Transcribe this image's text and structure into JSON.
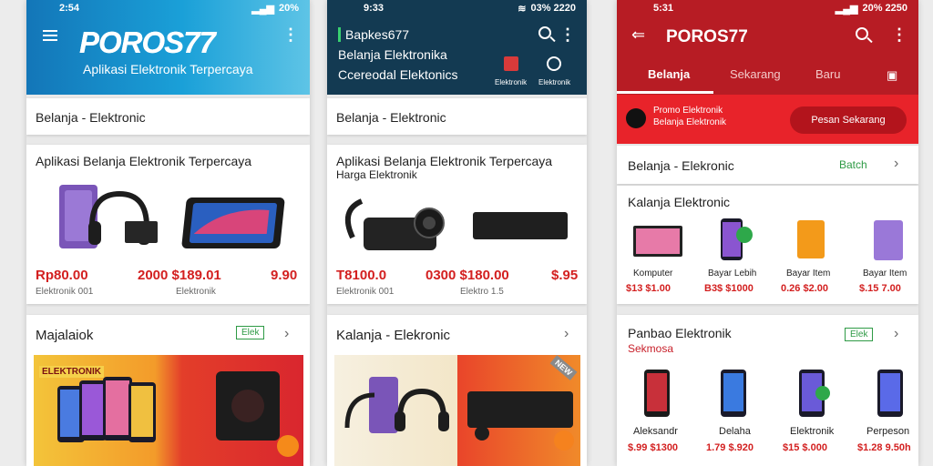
{
  "phone1": {
    "status": {
      "time": "2:54",
      "battery": "20%"
    },
    "logo": "POROS77",
    "tagline": "Aplikasi Elektronik Terpercaya",
    "category_bar": "Belanja - Elektronic",
    "card1": {
      "title": "Aplikasi Belanja Elektronik Terpercaya",
      "prices": [
        "Rp80.00",
        "2000 $189.01",
        "9.90"
      ],
      "subs": [
        "Elektronik 001",
        "Elektronik"
      ]
    },
    "card2": {
      "title": "Majalaiok",
      "badge": "Elek",
      "banner_label": "ELEKTRONIK"
    }
  },
  "phone2": {
    "status": {
      "time": "9:33",
      "battery": "03% 2220"
    },
    "title": "Bapkes677",
    "subtitle1": "Belanja Elektronika",
    "subtitle2": "Ccereodal Elektonics",
    "icon_labels": [
      "Elektronik",
      "Elektronik"
    ],
    "category_bar": "Belanja - Elektronic",
    "card1": {
      "title": "Aplikasi Belanja Elektronik Terpercaya",
      "subtitle": "Harga Elektronik",
      "prices": [
        "T8100.0",
        "0300 $180.00",
        "$.95"
      ],
      "subs": [
        "Elektronik 001",
        "Elektro 1.5"
      ]
    },
    "card2": {
      "title": "Kalanja - Elekronic",
      "ribbon": "NEW"
    }
  },
  "phone3": {
    "status": {
      "time": "5:31",
      "battery": "20% 2250"
    },
    "logo": "POROS77",
    "tabs": [
      "Belanja",
      "Sekarang",
      "Baru"
    ],
    "promo": {
      "line1": "Promo Elektronik",
      "line2": "Belanja Elektronik",
      "button": "Pesan Sekarang"
    },
    "row1": {
      "title": "Belanja - Elekronic",
      "link": "Batch"
    },
    "card1": {
      "title": "Kalanja Elektronic",
      "items": [
        {
          "name": "Komputer",
          "price": "$13 $1.00"
        },
        {
          "name": "Bayar Lebih",
          "price": "B3$ $1000"
        },
        {
          "name": "Bayar Item",
          "price": "0.26 $2.00"
        },
        {
          "name": "Bayar Item",
          "price": "$.15 7.00"
        }
      ]
    },
    "card2": {
      "title": "Panbao Elektronik",
      "subtitle": "Sekmosa",
      "badge": "Elek",
      "items": [
        {
          "name": "Aleksandr",
          "price": "$.99 $1300"
        },
        {
          "name": "Delaha",
          "price": "1.79 $.920"
        },
        {
          "name": "Elektronik",
          "price": "$15 $.000"
        },
        {
          "name": "Perpeson",
          "price": "$1.28 9.50h"
        }
      ]
    }
  },
  "colors": {
    "blue": "#1a8ac8",
    "navy": "#12354d",
    "red": "#c8202a",
    "price_red": "#d32020"
  }
}
